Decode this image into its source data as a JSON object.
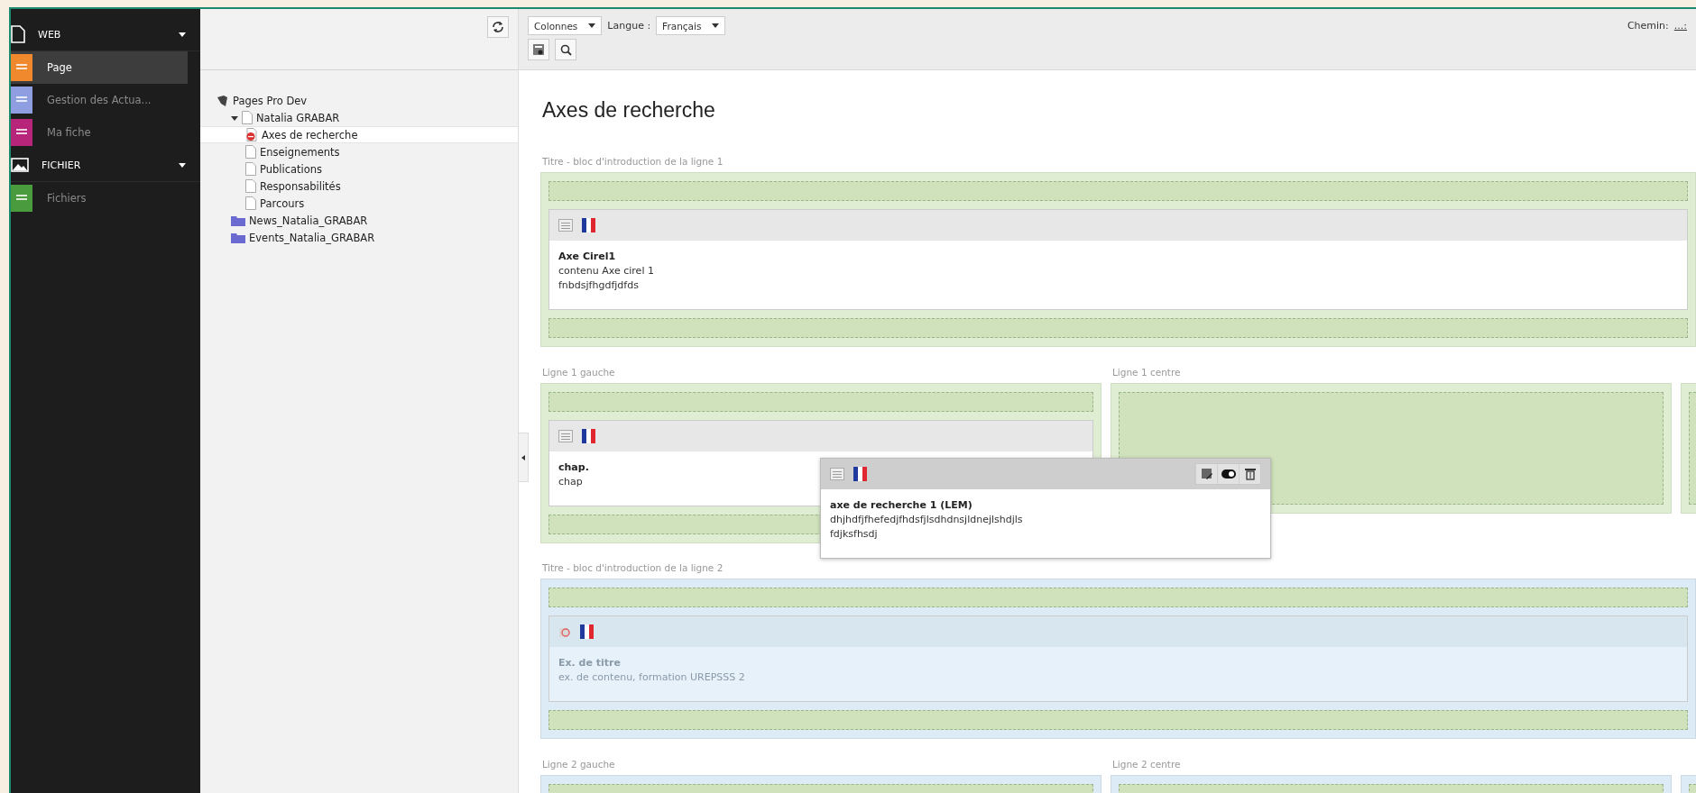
{
  "sidebar": {
    "groups": [
      {
        "label": "WEB",
        "kind": "page",
        "expanded": true,
        "items": [
          {
            "label": "Page",
            "color": "#f0892e",
            "selected": true
          },
          {
            "label": "Gestion des Actua...",
            "color": "#8f9ee0",
            "selected": false
          },
          {
            "label": "Ma fiche",
            "color": "#b7257a",
            "selected": false
          }
        ]
      },
      {
        "label": "FICHIER",
        "kind": "image",
        "expanded": true,
        "items": [
          {
            "label": "Fichiers",
            "color": "#4a9b3e",
            "selected": false
          }
        ]
      }
    ]
  },
  "tree": {
    "items": [
      {
        "label": "Pages Pro Dev",
        "kind": "root",
        "selected": false,
        "children": [
          {
            "label": "Natalia GRABAR",
            "kind": "page",
            "selected": false,
            "expanded": true,
            "children": [
              {
                "label": "Axes de recherche",
                "kind": "restricted",
                "selected": true
              },
              {
                "label": "Enseignements",
                "kind": "page",
                "selected": false
              },
              {
                "label": "Publications",
                "kind": "page",
                "selected": false
              },
              {
                "label": "Responsabilités",
                "kind": "page",
                "selected": false
              },
              {
                "label": "Parcours",
                "kind": "page",
                "selected": false
              }
            ]
          },
          {
            "label": "News_Natalia_GRABAR",
            "kind": "folder",
            "selected": false
          },
          {
            "label": "Events_Natalia_GRABAR",
            "kind": "folder",
            "selected": false
          }
        ]
      }
    ]
  },
  "toolbar": {
    "view": "Colonnes",
    "language_label": "Langue :",
    "language": "Français",
    "path_label": "Chemin:",
    "path": "...:"
  },
  "page_title": "Axes de recherche",
  "sections": [
    {
      "kind": "intro",
      "label": "Titre - bloc d'introduction de la ligne 1",
      "color": "#dfeed2",
      "cards": [
        {
          "title": "Axe Cirel1",
          "lines": [
            "contenu Axe cirel 1",
            "fnbdsjfhgdfjdfds"
          ],
          "hidden": false
        }
      ]
    },
    {
      "kind": "columns",
      "color": "#dfeed2",
      "columns": [
        {
          "label": "Ligne 1 gauche",
          "cards": [
            {
              "title": "chap.",
              "lines": [
                "chap"
              ],
              "hidden": false
            }
          ]
        },
        {
          "label": "Ligne 1 centre"
        },
        {}
      ]
    },
    {
      "kind": "intro",
      "label": "Titre - bloc d'introduction de la ligne 2",
      "color": "#dcebf6",
      "cards": [
        {
          "title": "Ex. de titre",
          "lines": [
            "ex. de contenu, formation UREPSSS 2"
          ],
          "hidden": true
        }
      ]
    },
    {
      "kind": "columns",
      "color": "#dcebf6",
      "columns": [
        {
          "label": "Ligne 2 gauche"
        },
        {
          "label": "Ligne 2 centre"
        },
        {}
      ]
    }
  ],
  "dragged_card": {
    "title": "axe de recherche 1 (LEM)",
    "lines": [
      "dhjhdfjfhefedjfhdsfjlsdhdnsjldnejlshdjls",
      "fdjksfhsdj"
    ],
    "hidden": false
  }
}
